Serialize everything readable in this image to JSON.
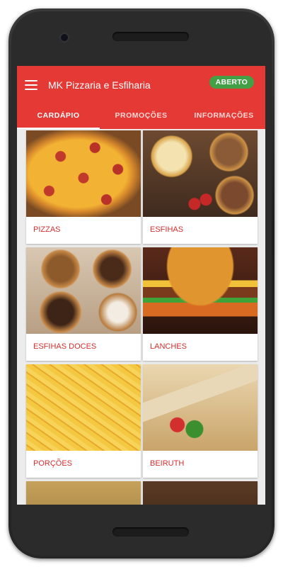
{
  "appbar": {
    "title": "MK Pizzaria e Esfiharia",
    "status_badge": "ABERTO"
  },
  "tabs": [
    {
      "label": "CARDÁPIO",
      "active": true
    },
    {
      "label": "PROMOÇÕES",
      "active": false
    },
    {
      "label": "INFORMAÇÕES",
      "active": false
    }
  ],
  "categories": [
    {
      "label": "PIZZAS"
    },
    {
      "label": "ESFIHAS"
    },
    {
      "label": "ESFIHAS DOCES"
    },
    {
      "label": "LANCHES"
    },
    {
      "label": "PORÇÕES"
    },
    {
      "label": "BEIRUTH"
    }
  ],
  "colors": {
    "primary": "#e53935",
    "badge": "#43a047",
    "label": "#d32f2f"
  }
}
